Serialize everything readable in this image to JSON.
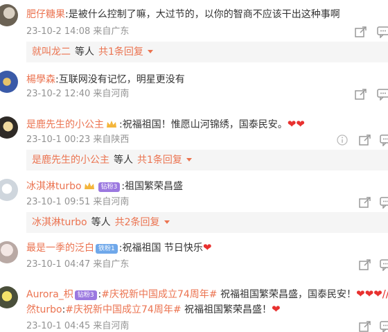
{
  "comments": [
    {
      "user": "肥仔糖果",
      "text": ":是被什么控制了嘛，大过节的，以你的智商不应该干出这种事啊",
      "time": "23-10-2 14:08",
      "location": "来自广东",
      "reply": {
        "user": "就叫龙二",
        "mid": "等人",
        "count": "共1条回复"
      }
    },
    {
      "user": "楊學森",
      "text": ":互联网没有记忆，明星更没有",
      "time": "23-10-2 12:40",
      "location": "来自河南"
    },
    {
      "user": "是鹿先生的小公主",
      "text": ":祝福祖国！惟愿山河锦绣，国泰民安。",
      "hearts": "❤❤",
      "time": "23-10-1 00:23",
      "location": "来自陕西",
      "reply": {
        "user": "是鹿先生的小公主",
        "mid": "等人",
        "count": "共1条回复"
      }
    },
    {
      "user": "冰淇淋turbo",
      "badge": "钻粉3",
      "text": ":祖国繁荣昌盛",
      "time": "23-10-1 09:51",
      "location": "来自河南",
      "reply": {
        "user": "冰淇淋turbo",
        "mid": "等人",
        "count": "共2条回复"
      }
    },
    {
      "user": "最是一季的泛白",
      "badge": "铁粉1",
      "text": ":祝福祖国 节日快乐",
      "hearts": "❤",
      "time": "23-10-1 04:47",
      "location": "来自广东"
    },
    {
      "user": "Aurora_枳",
      "badge": "钻粉3",
      "text_pre": ":",
      "topic": "#庆祝新中国成立74周年#",
      "text_post": " 祝福祖国繁荣昌盛，国泰民安！",
      "hearts": "❤❤❤//",
      "line2_user": "然turbo",
      "line2_pre": ":",
      "line2_topic": "#庆祝新中国成立74周年#",
      "line2_post": " 祝福祖国繁荣昌盛！",
      "line2_hearts": "❤",
      "time": "23-10-1 04:45",
      "location": "来自河南"
    }
  ],
  "colors": {
    "accent": "#eb7350",
    "meta": "#939393",
    "heart": "#e8312f"
  },
  "icons": [
    "share-icon",
    "comment-icon",
    "info-icon"
  ]
}
